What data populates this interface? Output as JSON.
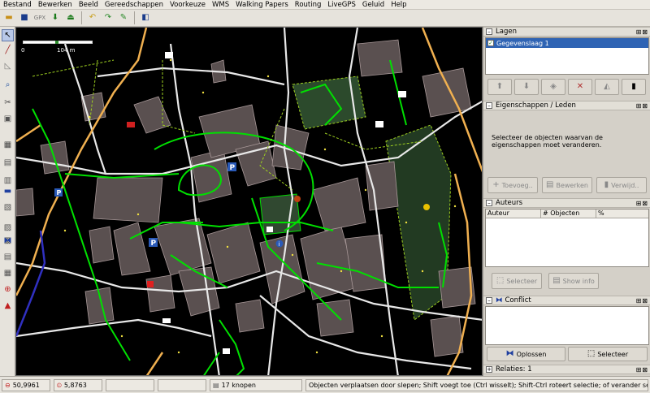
{
  "menu": [
    "Bestand",
    "Bewerken",
    "Beeld",
    "Gereedschappen",
    "Voorkeuze",
    "WMS",
    "Walking Papers",
    "Routing",
    "LiveGPS",
    "Geluid",
    "Help"
  ],
  "map": {
    "scale_start": "0",
    "scale_end": "104 m",
    "colors": {
      "background": "#000000",
      "road": "#f5f5f5",
      "main_road": "#f0b050",
      "footway": "#00e000",
      "building": "#5a5050",
      "landuse": "#304830",
      "water": "#3030c0",
      "node": "#f0e040"
    }
  },
  "layers": {
    "title": "Lagen",
    "items": [
      {
        "name": "Gegevenslaag 1",
        "checked": true
      }
    ]
  },
  "properties": {
    "title": "Eigenschappen / Leden",
    "message": "Selecteer de objecten waarvan de eigenschappen moet veranderen.",
    "buttons": {
      "add": "Toevoeg..",
      "edit": "Bewerken",
      "delete": "Verwijd.."
    }
  },
  "authors": {
    "title": "Auteurs",
    "columns": [
      "Auteur",
      "# Objecten",
      "%"
    ],
    "buttons": {
      "select": "Selecteer",
      "show": "Show info"
    }
  },
  "conflict": {
    "title": "Conflict",
    "buttons": {
      "resolve": "Oplossen",
      "select": "Selecteer"
    }
  },
  "relations": {
    "title": "Relaties: 1"
  },
  "status": {
    "lat": "50,9961",
    "lon": "5,8763",
    "nodes": "17 knopen",
    "hint": "Objecten verplaatsen door slepen; Shift voegt toe (Ctrl wisselt); Shift-Ctrl roteert selectie; of verander selectie"
  }
}
